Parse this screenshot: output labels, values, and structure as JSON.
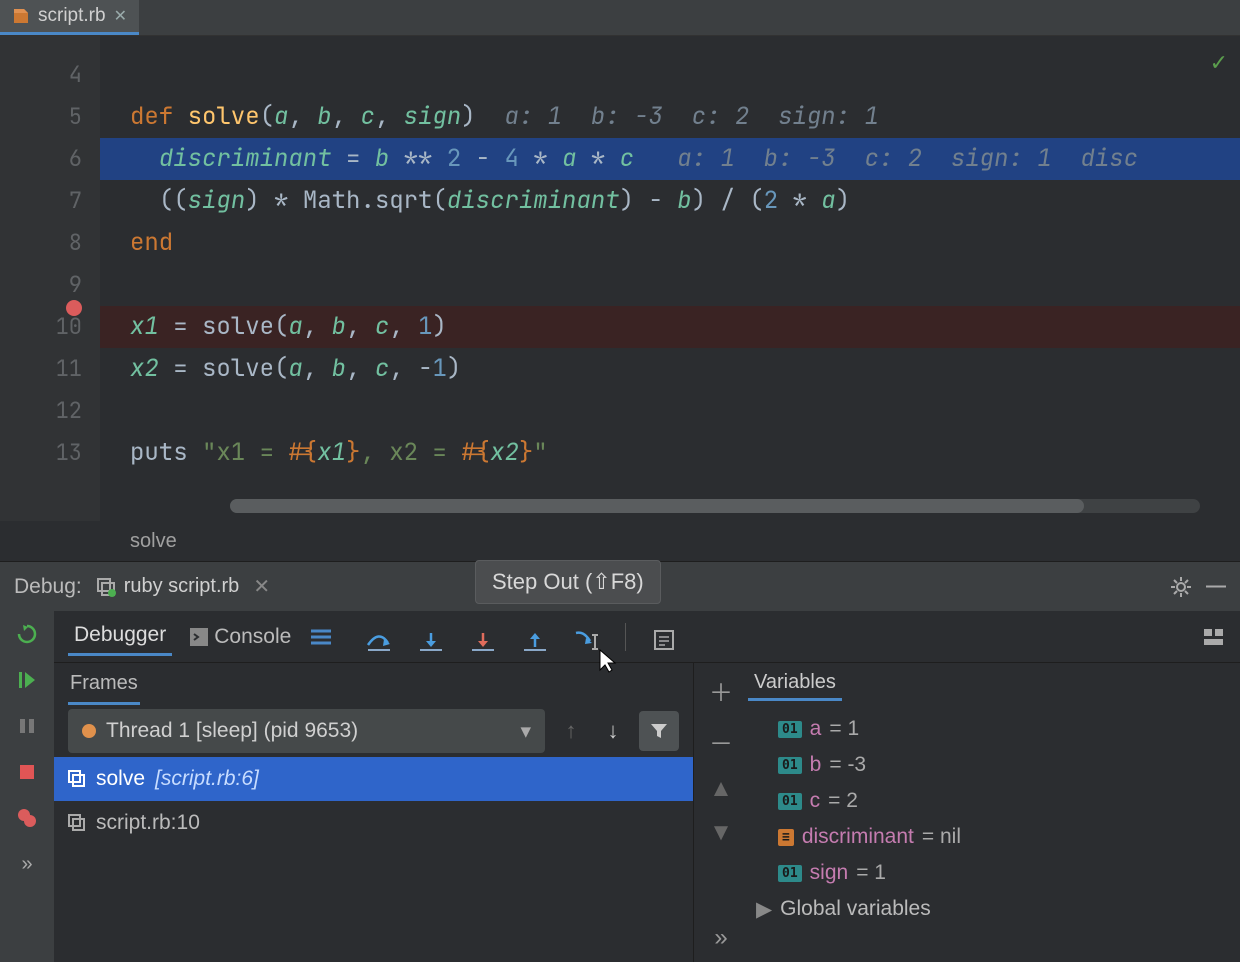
{
  "tab": {
    "filename": "script.rb"
  },
  "editor": {
    "lines": [
      "4",
      "5",
      "6",
      "7",
      "8",
      "9",
      "10",
      "11",
      "12",
      "13"
    ]
  },
  "code": {
    "l5": {
      "def": "def",
      "fn": "solve",
      "p": "(",
      "a": "a",
      "c1": ", ",
      "b": "b",
      "c2": ", ",
      "c": "c",
      "c3": ", ",
      "sign": "sign",
      "rp": ")",
      "hint": "  a: 1  b: -3  c: 2  sign: 1"
    },
    "l6": {
      "disc": "discriminant",
      "eq": " = ",
      "b": "b",
      "pow": " ** ",
      "two": "2",
      "minus": " - ",
      "four": "4",
      "times1": " * ",
      "a": "a",
      "times2": " * ",
      "c": "c",
      "hint": "   a: 1  b: -3  c: 2  sign: 1  disc"
    },
    "l7": {
      "pre": "((",
      "sign": "sign",
      "mid": ") * Math",
      "dot": ".",
      "sqrt": "sqrt",
      "op": "(",
      "disc": "discriminant",
      "cp": ") - ",
      "b": "b",
      "end": ") / (",
      "two": "2",
      "times": " * ",
      "a": "a",
      "rp": ")"
    },
    "l8": {
      "end": "end"
    },
    "l10": {
      "x1": "x1",
      "eq": " = solve(",
      "a": "a",
      "c1": ", ",
      "b": "b",
      "c2": ", ",
      "c": "c",
      "c3": ", ",
      "one": "1",
      "rp": ")"
    },
    "l11": {
      "x2": "x2",
      "eq": " = solve(",
      "a": "a",
      "c1": ", ",
      "b": "b",
      "c2": ", ",
      "c": "c",
      "c3": ", ",
      "neg": "-",
      "one": "1",
      "rp": ")"
    },
    "l13": {
      "puts": "puts ",
      "q1": "\"x1 = ",
      "i1": "#{",
      "x1": "x1",
      "e1": "}",
      "mid": ", x2 = ",
      "i2": "#{",
      "x2": "x2",
      "e2": "}",
      "q2": "\""
    }
  },
  "breadcrumb": "solve",
  "debug": {
    "title": "Debug:",
    "config": "ruby script.rb",
    "tabs": {
      "debugger": "Debugger",
      "console": "Console"
    },
    "tooltip": "Step Out (⇧F8)"
  },
  "frames": {
    "title": "Frames",
    "thread": "Thread 1 [sleep] (pid 9653)",
    "items": [
      {
        "name": "solve",
        "loc": "[script.rb:6]"
      },
      {
        "name": "script.rb:10",
        "loc": ""
      }
    ]
  },
  "variables": {
    "title": "Variables",
    "rows": [
      {
        "badge": "01",
        "name": "a",
        "val": " = 1"
      },
      {
        "badge": "01",
        "name": "b",
        "val": " = -3"
      },
      {
        "badge": "01",
        "name": "c",
        "val": " = 2"
      },
      {
        "badge": "obj",
        "name": "discriminant",
        "val": " = nil"
      },
      {
        "badge": "01",
        "name": "sign",
        "val": " = 1"
      }
    ],
    "globals": "Global variables"
  }
}
